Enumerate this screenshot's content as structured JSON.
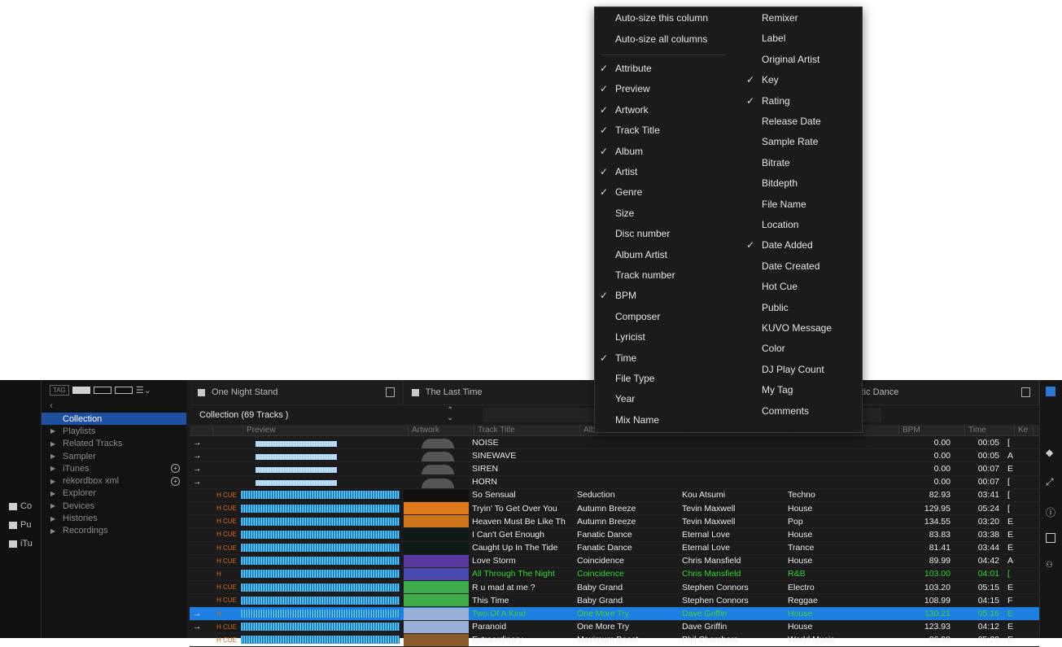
{
  "sidebar_left": [
    {
      "label": "Co",
      "icon": "collection-icon"
    },
    {
      "label": "Pu",
      "icon": "alert-icon"
    },
    {
      "label": "iTu",
      "icon": "folder-icon"
    }
  ],
  "toolbar": {
    "tag_label": "TAG"
  },
  "tree": {
    "items": [
      {
        "label": "Collection",
        "active": true
      },
      {
        "label": "Playlists"
      },
      {
        "label": "Related Tracks"
      },
      {
        "label": "Sampler"
      },
      {
        "label": "iTunes",
        "plus": true
      },
      {
        "label": "rekordbox xml",
        "plus": true
      },
      {
        "label": "Explorer"
      },
      {
        "label": "Devices"
      },
      {
        "label": "Histories"
      },
      {
        "label": "Recordings"
      }
    ]
  },
  "tabs": [
    {
      "label": "One Night Stand"
    },
    {
      "label": "The Last Time"
    },
    {
      "label": "tastic Dance"
    }
  ],
  "collection_title": "Collection (69 Tracks )",
  "columns": {
    "preview": "Preview",
    "artwork": "Artwork",
    "title": "Track Title",
    "album": "Album",
    "artist": "Artist",
    "genre": "Genre",
    "bpm": "BPM",
    "time": "Time",
    "key": "Ke"
  },
  "tracks": [
    {
      "arrow": "→",
      "attr": "",
      "title": "NOISE",
      "album": "",
      "artist": "",
      "genre": "",
      "bpm": "0.00",
      "time": "00:05",
      "key": "[",
      "art": "",
      "wave": "mono"
    },
    {
      "arrow": "→",
      "attr": "",
      "title": "SINEWAVE",
      "album": "",
      "artist": "",
      "genre": "",
      "bpm": "0.00",
      "time": "00:05",
      "key": "A",
      "art": "",
      "wave": "mono"
    },
    {
      "arrow": "→",
      "attr": "",
      "title": "SIREN",
      "album": "",
      "artist": "",
      "genre": "",
      "bpm": "0.00",
      "time": "00:07",
      "key": "E",
      "art": "",
      "wave": "mono"
    },
    {
      "arrow": "→",
      "attr": "",
      "title": "HORN",
      "album": "",
      "artist": "",
      "genre": "",
      "bpm": "0.00",
      "time": "00:07",
      "key": "[",
      "art": "",
      "wave": "mono"
    },
    {
      "arrow": "",
      "attr": "H CUE",
      "title": "So Sensual",
      "album": "Seduction",
      "artist": "Kou Atsumi",
      "genre": "Techno",
      "bpm": "82.93",
      "time": "03:41",
      "key": "[",
      "art": "#111111",
      "wave": "full"
    },
    {
      "arrow": "",
      "attr": "H CUE",
      "title": "Tryin' To Get Over You",
      "album": "Autumn Breeze",
      "artist": "Tevin Maxwell",
      "genre": "House",
      "bpm": "129.95",
      "time": "05:24",
      "key": "[",
      "art": "#e07a1a",
      "wave": "full"
    },
    {
      "arrow": "",
      "attr": "H CUE",
      "title": "Heaven Must Be Like Th",
      "album": "Autumn Breeze",
      "artist": "Tevin Maxwell",
      "genre": "Pop",
      "bpm": "134.55",
      "time": "03:20",
      "key": "E",
      "art": "#d0741a",
      "wave": "full"
    },
    {
      "arrow": "",
      "attr": "H CUE",
      "title": "I Can't Get Enough",
      "album": "Fanatic Dance",
      "artist": "Eternal Love",
      "genre": "House",
      "bpm": "83.83",
      "time": "03:38",
      "key": "E",
      "art": "#0e1a18",
      "wave": "full"
    },
    {
      "arrow": "",
      "attr": "H CUE",
      "title": "Caught Up In The Tide",
      "album": "Fanatic Dance",
      "artist": "Eternal Love",
      "genre": "Trance",
      "bpm": "81.41",
      "time": "03:44",
      "key": "E",
      "art": "#0e1a18",
      "wave": "full"
    },
    {
      "arrow": "",
      "attr": "H CUE",
      "title": "Love Storm",
      "album": "Coincidence",
      "artist": "Chris Mansfield",
      "genre": "House",
      "bpm": "89.99",
      "time": "04:42",
      "key": "A",
      "art": "#5a3aa0",
      "wave": "full"
    },
    {
      "arrow": "",
      "attr": "H",
      "title": "All Through The Night",
      "album": "Coincidence",
      "artist": "Chris Mansfield",
      "genre": "R&B",
      "bpm": "103.00",
      "time": "04:01",
      "key": "[",
      "art": "#4a4ab0",
      "wave": "full",
      "green": true
    },
    {
      "arrow": "",
      "attr": "H CUE",
      "title": "R u mad at me ?",
      "album": "Baby Grand",
      "artist": "Stephen Connors",
      "genre": "Electro",
      "bpm": "103.20",
      "time": "05:15",
      "key": "E",
      "art": "#3fae4a",
      "wave": "full"
    },
    {
      "arrow": "",
      "attr": "H CUE",
      "title": "This Time",
      "album": "Baby Grand",
      "artist": "Stephen Connors",
      "genre": "Reggae",
      "bpm": "108.99",
      "time": "04:15",
      "key": "F",
      "art": "#3fae4a",
      "wave": "full"
    },
    {
      "arrow": "→",
      "attr": "H",
      "title": "Two Of A Kind",
      "album": "One More Try",
      "artist": "Dave Griffin",
      "genre": "House",
      "bpm": "130.21",
      "time": "05:16",
      "key": "E",
      "art": "#9bb0d8",
      "wave": "full",
      "selected": true
    },
    {
      "arrow": "→",
      "attr": "H CUE",
      "title": "Paranoid",
      "album": "One More Try",
      "artist": "Dave Griffin",
      "genre": "House",
      "bpm": "123.93",
      "time": "04:12",
      "key": "E",
      "art": "#9bb0d8",
      "wave": "full"
    },
    {
      "arrow": "",
      "attr": "H CUE",
      "title": "Extraordinary",
      "album": "Maximum Boost",
      "artist": "Phil Chambers",
      "genre": "World Music",
      "bpm": "86.98",
      "time": "05:29",
      "key": "E",
      "art": "#8a5a2a",
      "wave": "full"
    }
  ],
  "context_menu": {
    "left": [
      {
        "label": "Auto-size this column",
        "checked": false
      },
      {
        "label": "Auto-size all columns",
        "checked": false
      },
      {
        "label": "Attribute",
        "checked": true
      },
      {
        "label": "Preview",
        "checked": true
      },
      {
        "label": "Artwork",
        "checked": true
      },
      {
        "label": "Track Title",
        "checked": true
      },
      {
        "label": "Album",
        "checked": true
      },
      {
        "label": "Artist",
        "checked": true
      },
      {
        "label": "Genre",
        "checked": true
      },
      {
        "label": "Size",
        "checked": false
      },
      {
        "label": "Disc number",
        "checked": false
      },
      {
        "label": "Album Artist",
        "checked": false
      },
      {
        "label": "Track number",
        "checked": false
      },
      {
        "label": "BPM",
        "checked": true
      },
      {
        "label": "Composer",
        "checked": false
      },
      {
        "label": "Lyricist",
        "checked": false
      },
      {
        "label": "Time",
        "checked": true
      },
      {
        "label": "File Type",
        "checked": false
      },
      {
        "label": "Year",
        "checked": false
      },
      {
        "label": "Mix Name",
        "checked": false
      }
    ],
    "right": [
      {
        "label": "Remixer",
        "checked": false
      },
      {
        "label": "Label",
        "checked": false
      },
      {
        "label": "Original Artist",
        "checked": false
      },
      {
        "label": "Key",
        "checked": true
      },
      {
        "label": "Rating",
        "checked": true
      },
      {
        "label": "Release Date",
        "checked": false
      },
      {
        "label": "Sample Rate",
        "checked": false
      },
      {
        "label": "Bitrate",
        "checked": false
      },
      {
        "label": "Bitdepth",
        "checked": false
      },
      {
        "label": "File Name",
        "checked": false
      },
      {
        "label": "Location",
        "checked": false
      },
      {
        "label": "Date Added",
        "checked": true
      },
      {
        "label": "Date Created",
        "checked": false
      },
      {
        "label": "Hot Cue",
        "checked": false
      },
      {
        "label": "Public",
        "checked": false
      },
      {
        "label": "KUVO Message",
        "checked": false
      },
      {
        "label": "Color",
        "checked": false
      },
      {
        "label": "DJ Play Count",
        "checked": false
      },
      {
        "label": "My Tag",
        "checked": false
      },
      {
        "label": "Comments",
        "checked": false
      }
    ],
    "check_glyph": "✓"
  }
}
